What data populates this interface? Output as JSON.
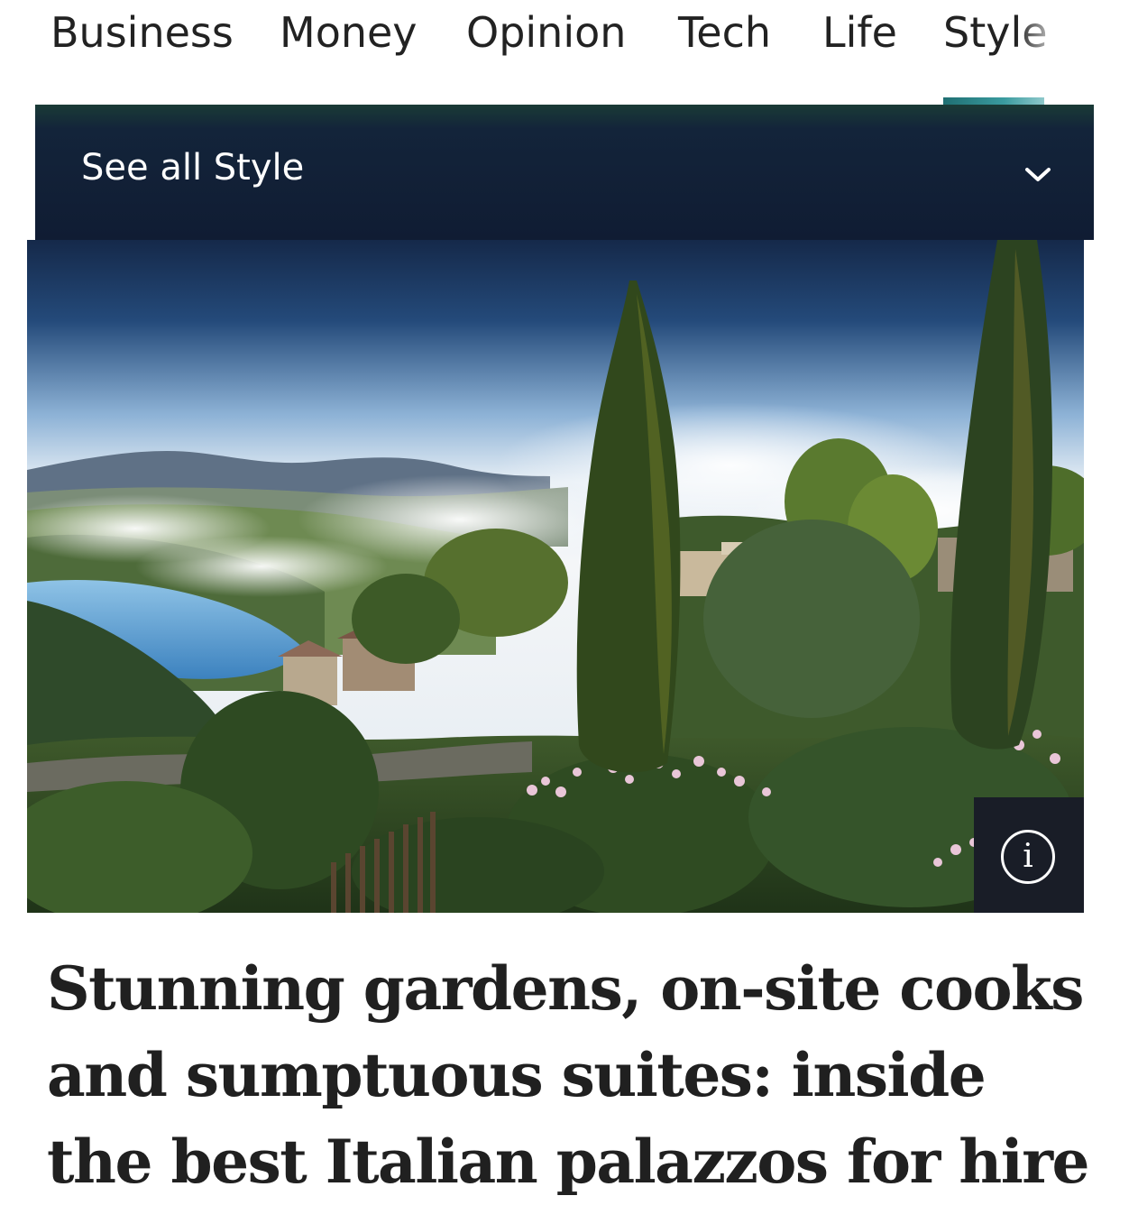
{
  "nav": {
    "items": [
      {
        "label": "Business"
      },
      {
        "label": "Money"
      },
      {
        "label": "Opinion"
      },
      {
        "label": "Tech"
      },
      {
        "label": "Life"
      },
      {
        "label": "Style",
        "active": true
      }
    ],
    "active_color": "#2b8a8e"
  },
  "section_menu": {
    "label": "See all Style",
    "icon": "chevron-down-icon",
    "background": "#111d33"
  },
  "hero": {
    "icon": "info-icon",
    "info_glyph": "i"
  },
  "article": {
    "headline": "Stunning gardens, on-site cooks and sumptuous suites: inside the best Italian palazzos for hire"
  }
}
